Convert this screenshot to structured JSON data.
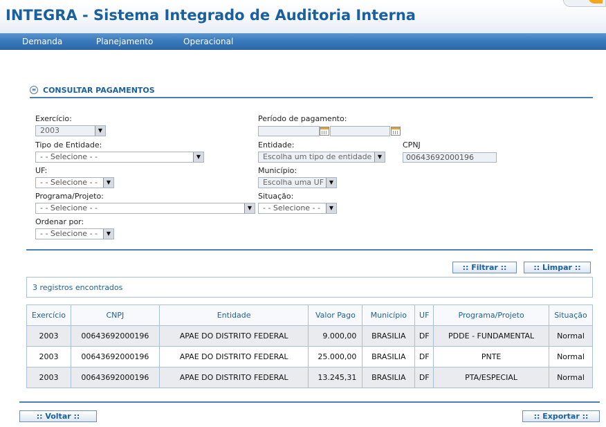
{
  "header": {
    "title": "INTEGRA - Sistema Integrado de Auditoria Interna"
  },
  "menu": [
    {
      "label": "Demanda"
    },
    {
      "label": "Planejamento"
    },
    {
      "label": "Operacional"
    }
  ],
  "section": {
    "title": "CONSULTAR PAGAMENTOS",
    "icon": "collapse-icon"
  },
  "form": {
    "exercicio": {
      "label": "Exercício:",
      "value": "2003"
    },
    "periodo": {
      "label": "Período de pagamento:",
      "start": "",
      "end": ""
    },
    "tipo_entidade": {
      "label": "Tipo de Entidade:",
      "value": "- - Selecione - -"
    },
    "entidade": {
      "label": "Entidade:",
      "value": "Escolha um tipo de entidade"
    },
    "cnpj": {
      "label": "CPNJ",
      "value": "00643692000196"
    },
    "uf": {
      "label": "UF:",
      "value": "- - Selecione - -"
    },
    "municipio": {
      "label": "Município:",
      "value": "Escolha uma UF"
    },
    "programa": {
      "label": "Programa/Projeto:",
      "value": "- - Selecione - -"
    },
    "situacao": {
      "label": "Situação:",
      "value": "- - Selecione - -"
    },
    "ordenar": {
      "label": "Ordenar por:",
      "value": "- - Selecione - -"
    }
  },
  "buttons": {
    "filtrar": ":: Filtrar ::",
    "limpar": ":: Limpar ::",
    "voltar": ":: Voltar ::",
    "exportar": ":: Exportar ::"
  },
  "results": {
    "count_text": "3 registros encontrados",
    "columns": [
      "Exercício",
      "CNPJ",
      "Entidade",
      "Valor Pago",
      "Município",
      "UF",
      "Programa/Projeto",
      "Situação"
    ],
    "rows": [
      [
        "2003",
        "00643692000196",
        "APAE DO DISTRITO FEDERAL",
        "9.000,00",
        "BRASILIA",
        "DF",
        "PDDE - FUNDAMENTAL",
        "Normal"
      ],
      [
        "2003",
        "00643692000196",
        "APAE DO DISTRITO FEDERAL",
        "25.000,00",
        "BRASILIA",
        "DF",
        "PNTE",
        "Normal"
      ],
      [
        "2003",
        "00643692000196",
        "APAE DO DISTRITO FEDERAL",
        "13.245,31",
        "BRASILIA",
        "DF",
        "PTA/ESPECIAL",
        "Normal"
      ]
    ]
  },
  "colors": {
    "brand": "#1a5f9e",
    "menubar": "#3b7bbd",
    "accent": "#f3a51c"
  }
}
